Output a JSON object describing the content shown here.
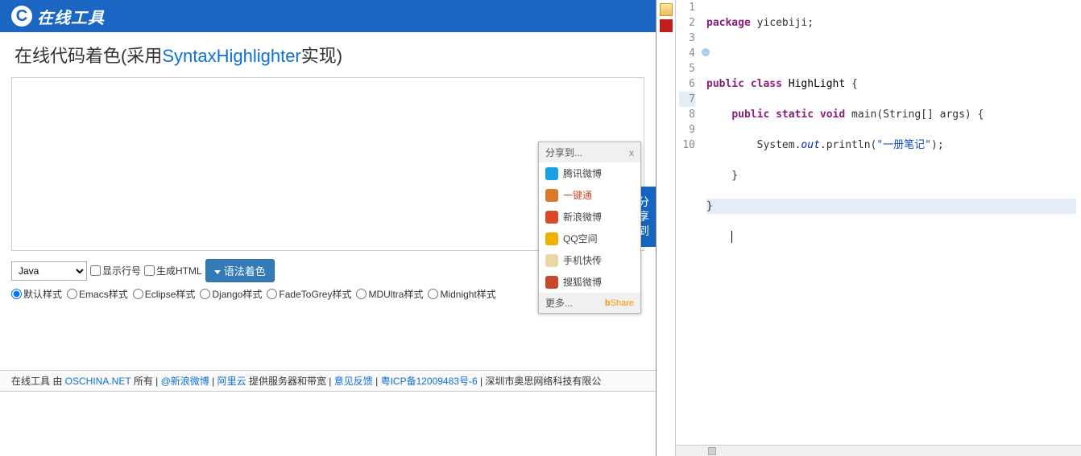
{
  "header": {
    "brand": "在线工具"
  },
  "title": {
    "prefix": "在线代码着色(采用",
    "link": "SyntaxHighlighter",
    "suffix": "实现)"
  },
  "share_tab": "分享到",
  "share_popup": {
    "title": "分享到...",
    "close": "x",
    "items": [
      {
        "label": "腾讯微博",
        "color": "#1aa0e6",
        "alt": false
      },
      {
        "label": "一键通",
        "color": "#d87a2a",
        "alt": true
      },
      {
        "label": "新浪微博",
        "color": "#d84a2a",
        "alt": false
      },
      {
        "label": "QQ空间",
        "color": "#f0b000",
        "alt": false
      },
      {
        "label": "手机快传",
        "color": "#e8d8a8",
        "alt": false
      },
      {
        "label": "搜狐微博",
        "color": "#c44a2a",
        "alt": false
      }
    ],
    "more": "更多...",
    "brand_prefix": "b",
    "brand_rest": "Share"
  },
  "controls": {
    "language": "Java",
    "show_lineno": "显示行号",
    "gen_html": "生成HTML",
    "colorize": "语法着色"
  },
  "styles": [
    "默认样式",
    "Emacs样式",
    "Eclipse样式",
    "Django样式",
    "FadeToGrey样式",
    "MDUltra样式",
    "Midnight样式"
  ],
  "footer": {
    "t1": "在线工具 由 ",
    "oschina": "OSCHINA.NET",
    "t2": " 所有 | ",
    "weibo": "@新浪微博",
    "t3": " | ",
    "aliyun": "阿里云",
    "t4": "提供服务器和带宽 | ",
    "feedback": "意见反馈",
    "t5": " | ",
    "icp": "粤ICP备12009483号-6",
    "t6": " | 深圳市奥思网络科技有限公"
  },
  "editor": {
    "lines": [
      "1",
      "2",
      "3",
      "4",
      "5",
      "6",
      "7",
      "8",
      "9",
      "10"
    ],
    "highlight_line": 7,
    "anno_line": 4,
    "code": {
      "l1": {
        "kw1": "package",
        "rest": " yicebiji;"
      },
      "l3": {
        "kw1": "public",
        "kw2": "class",
        "typ": "HighLight",
        "brace": "{"
      },
      "l4": {
        "kw1": "public",
        "kw2": "static",
        "kw3": "void",
        "m": "main(String[] args) {"
      },
      "l5": {
        "pre": "System.",
        "fld": "out",
        "post": ".println(",
        "str": "\"一册笔记\"",
        "end": ");"
      },
      "l6": "    }",
      "l7": "}"
    }
  }
}
